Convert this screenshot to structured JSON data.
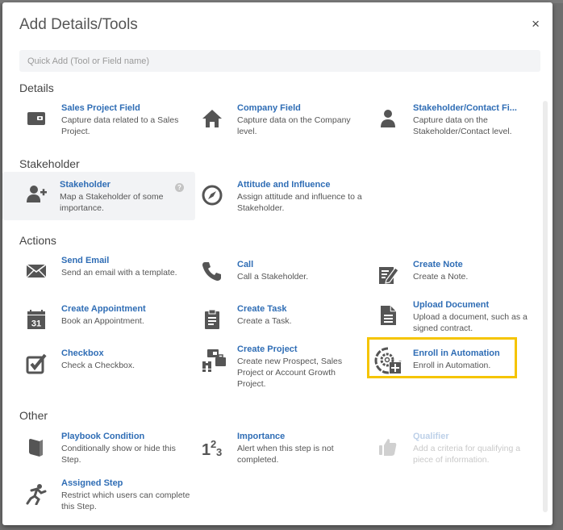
{
  "modal": {
    "title": "Add Details/Tools",
    "close_label": "×",
    "search_placeholder": "Quick Add (Tool or Field name)"
  },
  "sections": {
    "details": {
      "title": "Details",
      "items": [
        {
          "name": "Sales Project Field",
          "desc": "Capture data related to a Sales Project.",
          "icon": "wallet-icon"
        },
        {
          "name": "Company Field",
          "desc": "Capture data on the Company level.",
          "icon": "home-icon"
        },
        {
          "name": "Stakeholder/Contact Fi...",
          "desc": "Capture data on the Stakeholder/Contact level.",
          "icon": "person-icon"
        }
      ]
    },
    "stakeholder": {
      "title": "Stakeholder",
      "items": [
        {
          "name": "Stakeholder",
          "desc": "Map a Stakeholder of some importance.",
          "icon": "add-user-icon",
          "help": "?"
        },
        {
          "name": "Attitude and Influence",
          "desc": "Assign attitude and influence to a Stakeholder.",
          "icon": "compass-icon"
        }
      ]
    },
    "actions": {
      "title": "Actions",
      "items": [
        {
          "name": "Send Email",
          "desc": "Send an email with a template.",
          "icon": "envelope-icon"
        },
        {
          "name": "Call",
          "desc": "Call a Stakeholder.",
          "icon": "phone-icon"
        },
        {
          "name": "Create Note",
          "desc": "Create a Note.",
          "icon": "edit-note-icon"
        },
        {
          "name": "Create Appointment",
          "desc": "Book an Appointment.",
          "icon": "calendar-icon",
          "icon_text": "31"
        },
        {
          "name": "Create Task",
          "desc": "Create a Task.",
          "icon": "clipboard-icon"
        },
        {
          "name": "Upload Document",
          "desc": "Upload a document, such as a signed contract.",
          "icon": "document-icon"
        },
        {
          "name": "Checkbox",
          "desc": "Check a Checkbox.",
          "icon": "checkbox-icon"
        },
        {
          "name": "Create Project",
          "desc": "Create new Prospect, Sales Project or Account Growth Project.",
          "icon": "project-icon"
        },
        {
          "name": "Enroll in Automation",
          "desc": "Enroll in Automation.",
          "icon": "automation-icon"
        }
      ]
    },
    "other": {
      "title": "Other",
      "items": [
        {
          "name": "Playbook Condition",
          "desc": "Conditionally show or hide this Step.",
          "icon": "book-icon"
        },
        {
          "name": "Importance",
          "desc": "Alert when this step is not completed.",
          "icon": "numbers-icon"
        },
        {
          "name": "Qualifier",
          "desc": "Add a criteria for qualifying a piece of information.",
          "icon": "thumbs-up-icon",
          "disabled": true
        },
        {
          "name": "Assigned Step",
          "desc": "Restrict which users can complete this Step.",
          "icon": "runner-icon"
        }
      ]
    }
  },
  "colors": {
    "link": "#2f6db5",
    "highlight": "#f5c400",
    "icon": "#555555"
  }
}
